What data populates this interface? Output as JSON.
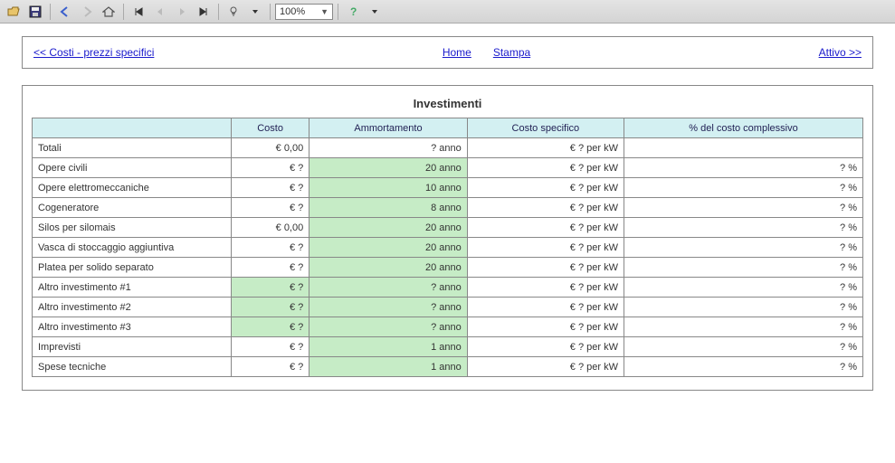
{
  "toolbar": {
    "zoom": "100%"
  },
  "linkbar": {
    "back": "<< Costi - prezzi specifici",
    "home": "Home",
    "print": "Stampa",
    "forward": "Attivo >>"
  },
  "table": {
    "title": "Investimenti",
    "headers": {
      "col0": "",
      "col1": "Costo",
      "col2": "Ammortamento",
      "col3": "Costo specifico",
      "col4": "% del costo complessivo"
    },
    "rows": [
      {
        "label": "Totali",
        "costo": "€ 0,00",
        "costo_green": false,
        "amm": "? anno",
        "amm_green": false,
        "spec": "€ ? per kW",
        "pct": ""
      },
      {
        "label": "Opere civili",
        "costo": "€ ?",
        "costo_green": false,
        "amm": "20 anno",
        "amm_green": true,
        "spec": "€ ? per kW",
        "pct": "? %"
      },
      {
        "label": "Opere elettromeccaniche",
        "costo": "€ ?",
        "costo_green": false,
        "amm": "10 anno",
        "amm_green": true,
        "spec": "€ ? per kW",
        "pct": "? %"
      },
      {
        "label": "Cogeneratore",
        "costo": "€ ?",
        "costo_green": false,
        "amm": "8 anno",
        "amm_green": true,
        "spec": "€ ? per kW",
        "pct": "? %"
      },
      {
        "label": "Silos per silomais",
        "costo": "€ 0,00",
        "costo_green": false,
        "amm": "20 anno",
        "amm_green": true,
        "spec": "€ ? per kW",
        "pct": "? %"
      },
      {
        "label": "Vasca di stoccaggio aggiuntiva",
        "costo": "€ ?",
        "costo_green": false,
        "amm": "20 anno",
        "amm_green": true,
        "spec": "€ ? per kW",
        "pct": "? %"
      },
      {
        "label": "Platea per solido separato",
        "costo": "€ ?",
        "costo_green": false,
        "amm": "20 anno",
        "amm_green": true,
        "spec": "€ ? per kW",
        "pct": "? %"
      },
      {
        "label": "Altro investimento #1",
        "costo": "€ ?",
        "costo_green": true,
        "amm": "? anno",
        "amm_green": true,
        "spec": "€ ? per kW",
        "pct": "? %"
      },
      {
        "label": "Altro investimento #2",
        "costo": "€ ?",
        "costo_green": true,
        "amm": "? anno",
        "amm_green": true,
        "spec": "€ ? per kW",
        "pct": "? %"
      },
      {
        "label": "Altro investimento #3",
        "costo": "€ ?",
        "costo_green": true,
        "amm": "? anno",
        "amm_green": true,
        "spec": "€ ? per kW",
        "pct": "? %"
      },
      {
        "label": "Imprevisti",
        "costo": "€ ?",
        "costo_green": false,
        "amm": "1 anno",
        "amm_green": true,
        "spec": "€ ? per kW",
        "pct": "? %"
      },
      {
        "label": "Spese tecniche",
        "costo": "€ ?",
        "costo_green": false,
        "amm": "1 anno",
        "amm_green": true,
        "spec": "€ ? per kW",
        "pct": "? %"
      }
    ]
  }
}
